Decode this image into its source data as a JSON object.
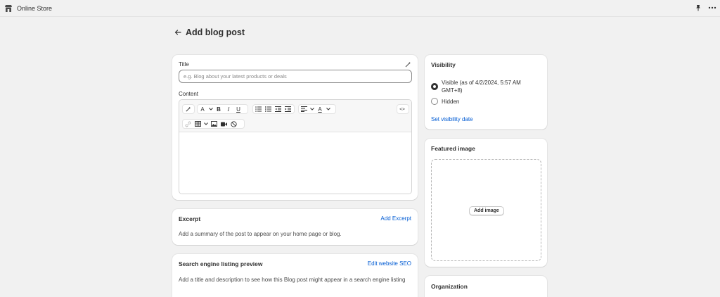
{
  "topbar": {
    "app_title": "Online Store",
    "icons": [
      "store-icon",
      "pin-icon",
      "more-horizontal-icon"
    ]
  },
  "page": {
    "title": "Add blog post",
    "back_icon": "arrow-left-icon"
  },
  "main_card": {
    "title_label": "Title",
    "title_placeholder": "e.g. Blog about your latest products or deals",
    "title_value": "",
    "content_label": "Content",
    "editor_toolbar": {
      "row1": [
        "magic-icon",
        "text-style-icon",
        "chevron-down-icon",
        "bold-icon",
        "italic-icon",
        "underline-icon",
        "bulleted-list-icon",
        "numbered-list-icon",
        "outdent-icon",
        "indent-icon",
        "align-left-icon",
        "chevron-down-icon",
        "text-color-icon",
        "chevron-down-icon",
        "code-view-icon"
      ],
      "row2": [
        "link-icon",
        "table-icon",
        "chevron-down-icon",
        "image-icon",
        "video-icon",
        "clear-formatting-icon"
      ],
      "labels": {
        "text_style": "A",
        "bold": "B",
        "italic": "I",
        "underline": "U",
        "text_color": "A",
        "code": "<>"
      }
    },
    "content_value": ""
  },
  "excerpt_card": {
    "title": "Excerpt",
    "action": "Add Excerpt",
    "description": "Add a summary of the post to appear on your home page or blog."
  },
  "seo_card": {
    "title": "Search engine listing preview",
    "action": "Edit website SEO",
    "description": "Add a title and description to see how this Blog post might appear in a search engine listing"
  },
  "visibility_card": {
    "title": "Visibility",
    "options": [
      {
        "line1": "Visible (as of 4/2/2024, 5:57 AM",
        "line2": "GMT+8)",
        "selected": true
      },
      {
        "line1": "Hidden",
        "selected": false
      }
    ],
    "set_date_link": "Set visibility date"
  },
  "featured_image_card": {
    "title": "Featured image",
    "button": "Add image"
  },
  "organization_card": {
    "title": "Organization"
  },
  "colors": {
    "background": "#f1f1f1",
    "card": "#ffffff",
    "link": "#005bd3",
    "text": "#303030"
  }
}
